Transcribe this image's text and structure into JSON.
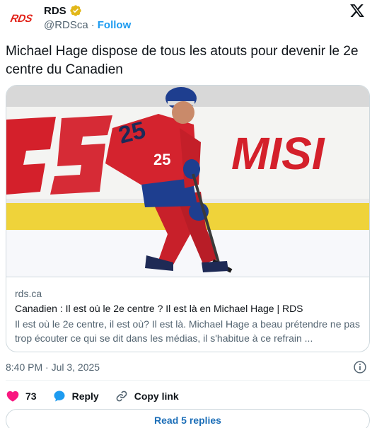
{
  "author": {
    "avatar_text": "RDS",
    "display_name": "RDS",
    "handle": "@RDSca",
    "separator": "·",
    "follow_label": "Follow"
  },
  "tweet": {
    "text": "Michael Hage dispose de tous les atouts pour devenir le 2e centre du Canadien"
  },
  "card": {
    "image_description_icon": "hockey-photo",
    "rink_text_left": "ES",
    "rink_text_right": "MISI",
    "jersey_number": "25",
    "domain": "rds.ca",
    "title": "Canadien : Il est où le 2e centre ? Il est là en Michael Hage | RDS",
    "description": "Il est où le 2e centre, il est où? Il est là. Michael Hage a beau prétendre ne pas trop écouter ce qui se dit dans les médias, il s'habitue à ce refrain ..."
  },
  "timestamp": "8:40 PM · Jul 3, 2025",
  "actions": {
    "likes_count": "73",
    "reply_label": "Reply",
    "copy_link_label": "Copy link"
  },
  "read_replies_label": "Read 5 replies",
  "colors": {
    "accent": "#1d9bf0",
    "heart": "#f91880",
    "brand_red": "#e2231a"
  }
}
